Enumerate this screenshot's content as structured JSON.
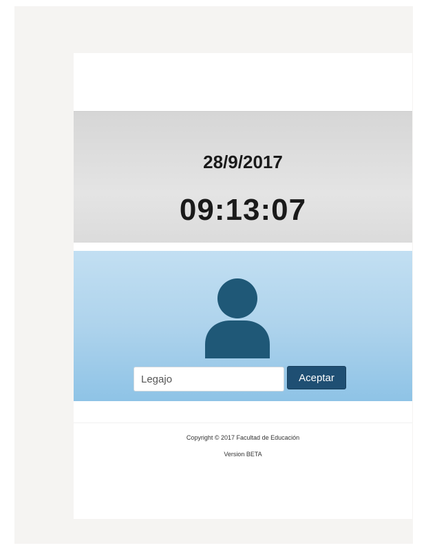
{
  "clock": {
    "date": "28/9/2017",
    "time": "09:13:07"
  },
  "login": {
    "avatar_icon": "user-icon",
    "legajo_placeholder": "Legajo",
    "legajo_value": "",
    "accept_label": "Aceptar"
  },
  "footer": {
    "copyright": "Copyright © 2017 Facultad de Educación",
    "version": "Version BETA"
  },
  "colors": {
    "accent": "#1f4f73",
    "avatar": "#1f5877",
    "login_background": "#aed3ec",
    "clock_background": "#dcdcdc"
  }
}
